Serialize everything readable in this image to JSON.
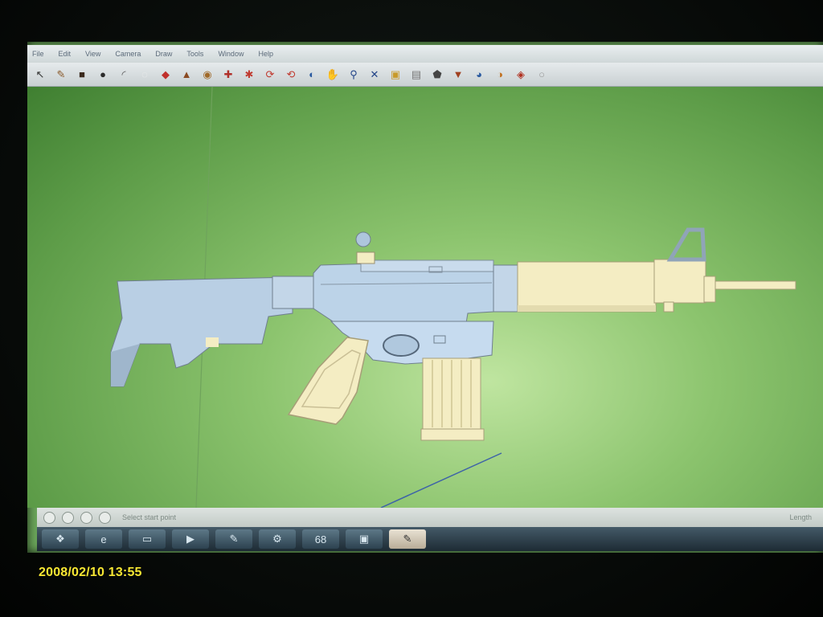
{
  "menu": {
    "items": [
      "File",
      "Edit",
      "View",
      "Camera",
      "Draw",
      "Tools",
      "Window",
      "Help"
    ]
  },
  "toolbar": {
    "tools": [
      {
        "name": "select-arrow-icon",
        "glyph": "↖",
        "color": "#333333"
      },
      {
        "name": "pencil-icon",
        "glyph": "✎",
        "color": "#8a5a2b"
      },
      {
        "name": "rectangle-icon",
        "glyph": "■",
        "color": "#3b2a1e"
      },
      {
        "name": "circle-icon",
        "glyph": "●",
        "color": "#2b2b2b"
      },
      {
        "name": "arc-icon",
        "glyph": "◜",
        "color": "#555555"
      },
      {
        "name": "eraser-icon",
        "glyph": "◌",
        "color": "#eeeeee"
      },
      {
        "name": "paint-bucket-icon",
        "glyph": "◆",
        "color": "#c0302c"
      },
      {
        "name": "push-pull-icon",
        "glyph": "▲",
        "color": "#8a4a22"
      },
      {
        "name": "follow-me-icon",
        "glyph": "◉",
        "color": "#a06a2a"
      },
      {
        "name": "move-icon",
        "glyph": "✚",
        "color": "#b0302a"
      },
      {
        "name": "rotate-icon",
        "glyph": "✱",
        "color": "#c03a30"
      },
      {
        "name": "scale-icon",
        "glyph": "⟳",
        "color": "#c03a30"
      },
      {
        "name": "offset-icon",
        "glyph": "⟲",
        "color": "#c03a30"
      },
      {
        "name": "orbit-icon",
        "glyph": "◐",
        "color": "#2a5aa0"
      },
      {
        "name": "pan-icon",
        "glyph": "✋",
        "color": "#666666"
      },
      {
        "name": "zoom-icon",
        "glyph": "⚲",
        "color": "#224488"
      },
      {
        "name": "zoom-extents-icon",
        "glyph": "✕",
        "color": "#224488"
      },
      {
        "name": "iso-view-icon",
        "glyph": "▣",
        "color": "#c89a2a"
      },
      {
        "name": "top-view-icon",
        "glyph": "▤",
        "color": "#777777"
      },
      {
        "name": "front-view-icon",
        "glyph": "⬟",
        "color": "#444444"
      },
      {
        "name": "walk-icon",
        "glyph": "▼",
        "color": "#a04020"
      },
      {
        "name": "look-around-icon",
        "glyph": "◕",
        "color": "#2a5aa0"
      },
      {
        "name": "section-plane-icon",
        "glyph": "◑",
        "color": "#c07020"
      },
      {
        "name": "components-icon",
        "glyph": "◈",
        "color": "#b03020"
      },
      {
        "name": "help-icon",
        "glyph": "○",
        "color": "#999999"
      }
    ]
  },
  "statusbar": {
    "hint": "Select start point",
    "measure_label": "Length"
  },
  "taskbar": {
    "buttons": [
      {
        "name": "start-button-icon",
        "glyph": "❖"
      },
      {
        "name": "ie-task-icon",
        "glyph": "e"
      },
      {
        "name": "explorer-task-icon",
        "glyph": "▭"
      },
      {
        "name": "media-task-icon",
        "glyph": "▶"
      },
      {
        "name": "tool-task-icon",
        "glyph": "✎"
      },
      {
        "name": "app-task-icon",
        "glyph": "⚙"
      },
      {
        "name": "counter-task",
        "glyph": "68"
      },
      {
        "name": "window-task-icon",
        "glyph": "▣"
      },
      {
        "name": "sketchup-task-icon",
        "glyph": "✎",
        "active": true
      }
    ]
  },
  "timestamp": "2008/02/10 13:55",
  "colors": {
    "viewport_light": "#bfe5a0",
    "viewport_dark": "#3f7f31",
    "model_blue": "#b9cfe4",
    "model_cream": "#f4edc3",
    "timestamp": "#f7e733"
  }
}
